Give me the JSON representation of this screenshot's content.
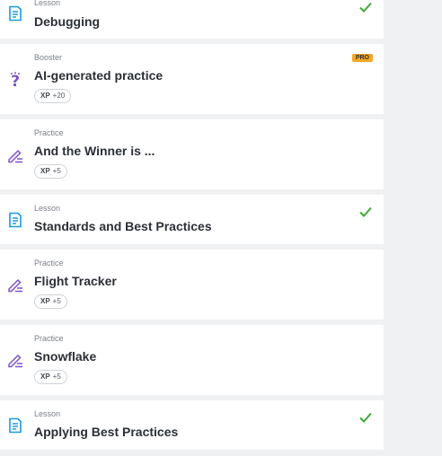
{
  "lessons": [
    {
      "kind": "Lesson",
      "title": "Debugging",
      "completed": true,
      "icon": "lesson-icon"
    },
    {
      "kind": "Booster",
      "title": "AI-generated practice",
      "xp_label": "XP",
      "xp_value": "+20",
      "badge": "PRO",
      "icon": "question-icon"
    },
    {
      "kind": "Practice",
      "title": "And the Winner is ...",
      "xp_label": "XP",
      "xp_value": "+5",
      "icon": "practice-pencil-icon"
    },
    {
      "kind": "Lesson",
      "title": "Standards and Best Practices",
      "completed": true,
      "icon": "lesson-icon"
    },
    {
      "kind": "Practice",
      "title": "Flight Tracker",
      "xp_label": "XP",
      "xp_value": "+5",
      "icon": "practice-pencil-icon"
    },
    {
      "kind": "Practice",
      "title": "Snowflake",
      "xp_label": "XP",
      "xp_value": "+5",
      "icon": "practice-pencil-icon"
    },
    {
      "kind": "Lesson",
      "title": "Applying Best Practices",
      "completed": true,
      "icon": "lesson-icon"
    }
  ],
  "colors": {
    "lesson_icon": "#1a9be0",
    "practice_icon": "#7c52c8",
    "check": "#3fa836",
    "pro_badge": "#f5a623",
    "background": "#eff1f3"
  }
}
